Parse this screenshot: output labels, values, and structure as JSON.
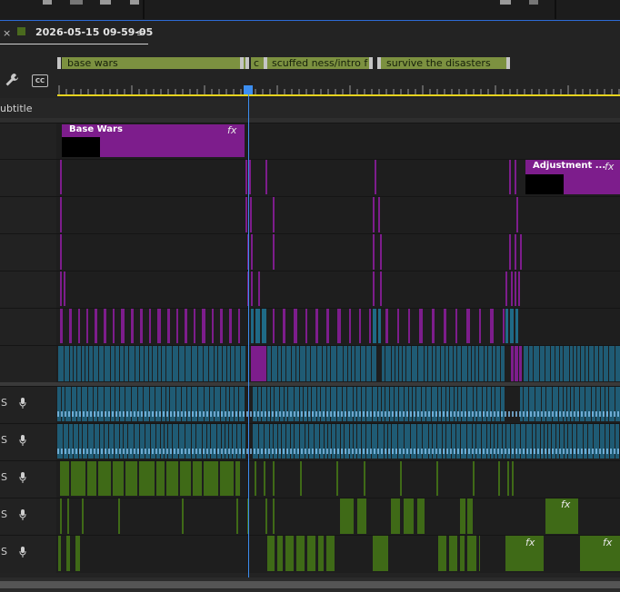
{
  "sequence_tab": {
    "close_glyph": "×",
    "title": "2026-05-15 09-59-05",
    "menu_glyph": "≡",
    "label_color": "#4a6a1e"
  },
  "markers": [
    {
      "label": "base wars"
    },
    {
      "label": "c"
    },
    {
      "label": "scuffed ness/intro f"
    },
    {
      "label": "survive the disasters"
    }
  ],
  "toolbar": {
    "wrench_icon": "wrench-icon",
    "cc_label": "CC"
  },
  "subtitle_track": {
    "label": "ubtitle"
  },
  "video_clips": [
    {
      "name": "Base Wars",
      "fx": "fx"
    },
    {
      "name": "Adjustment ...",
      "fx": "fx"
    }
  ],
  "audio_tracks": [
    {
      "label": "S"
    },
    {
      "label": "S"
    },
    {
      "label": "S"
    },
    {
      "label": "S"
    },
    {
      "label": "S"
    }
  ],
  "audio_fx": [
    "fx",
    "fx",
    "fx"
  ],
  "colors": {
    "playhead": "#3c8ef0",
    "work_area": "#e6d31e",
    "video_clip": "#7d1d8c",
    "audio_blue": "#1f5b74",
    "audio_green": "#3f6a17",
    "marker": "#7c9140"
  }
}
